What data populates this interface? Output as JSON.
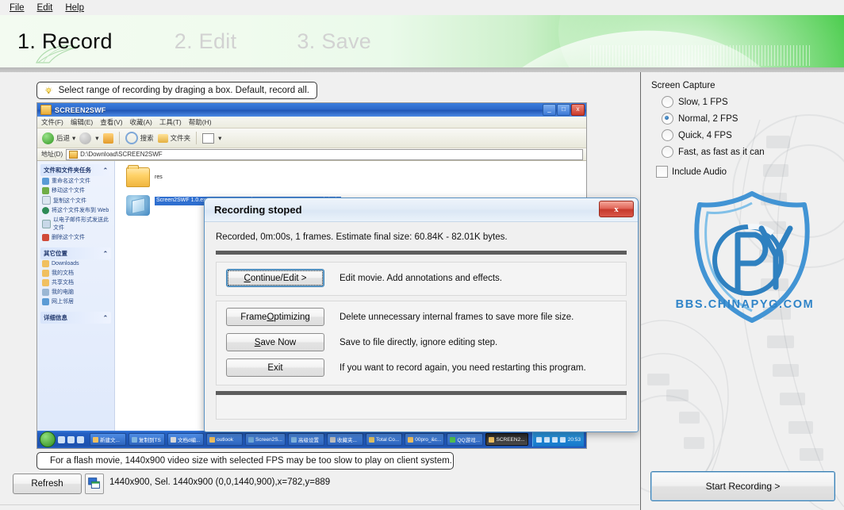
{
  "menubar": {
    "items": [
      {
        "label": "File",
        "accel": "F"
      },
      {
        "label": "Edit",
        "accel": "E"
      },
      {
        "label": "Help",
        "accel": "H"
      }
    ]
  },
  "banner": {
    "steps": [
      {
        "label": "1. Record",
        "active": true
      },
      {
        "label": "2. Edit",
        "active": false
      },
      {
        "label": "3. Save",
        "active": false
      }
    ]
  },
  "hints": {
    "top": "Select range of recording by draging a box. Default, record all.",
    "bottom": "For a flash movie, 1440x900 video size with selected FPS may be too slow to play on client system."
  },
  "preview": {
    "window_title": "SCREEN2SWF",
    "menu_items": [
      "文件(F)",
      "编辑(E)",
      "查看(V)",
      "收藏(A)",
      "工具(T)",
      "帮助(H)"
    ],
    "toolbar": {
      "back": "后退",
      "search": "搜索",
      "folders": "文件夹"
    },
    "address_label": "地址(D)",
    "address_value": "D:\\Download\\SCREEN2SWF",
    "side_panels": [
      {
        "title": "文件和文件夹任务",
        "rows": [
          {
            "label": "重命名这个文件",
            "color": "#5b9bd5"
          },
          {
            "label": "移动这个文件",
            "color": "#70ad47"
          },
          {
            "label": "复制这个文件",
            "color": "#dbe5f1"
          },
          {
            "label": "将这个文件发布到 Web",
            "color": "#2e8b57"
          },
          {
            "label": "以电子邮件形式发送此文件",
            "color": "#c8d8e8"
          },
          {
            "label": "删除这个文件",
            "color": "#d04a3a"
          }
        ]
      },
      {
        "title": "其它位置",
        "rows": [
          {
            "label": "Downloads",
            "color": "#f0c060"
          },
          {
            "label": "我的文档",
            "color": "#f0c060"
          },
          {
            "label": "共享文档",
            "color": "#f0c060"
          },
          {
            "label": "我的电脑",
            "color": "#9bb7d4"
          },
          {
            "label": "网上邻居",
            "color": "#5b9bd5"
          }
        ]
      },
      {
        "title": "详细信息",
        "rows": []
      }
    ],
    "files": [
      {
        "name": "res",
        "type": "folder",
        "selected": false
      },
      {
        "name": "Screen2SWF  1.0.exe\nSCREEN2SWF / SCREEN2SWF\nScreen movie/Job,",
        "type": "exe",
        "selected": true
      }
    ],
    "taskbar": {
      "buttons": [
        {
          "label": "新建文...",
          "color": "#f0c060",
          "active": false
        },
        {
          "label": "复制到TS",
          "color": "#7fb4e0",
          "active": false
        },
        {
          "label": "文档d编...",
          "color": "#d8d8d8",
          "active": false
        },
        {
          "label": "outlook",
          "color": "#f0c060",
          "active": false
        },
        {
          "label": "Screen2S...",
          "color": "#6fa8d8",
          "active": false
        },
        {
          "label": "高级设置",
          "color": "#7fb4e0",
          "active": false
        },
        {
          "label": "收藏夹...",
          "color": "#bfbfbf",
          "active": false
        },
        {
          "label": "Total Co...",
          "color": "#e0c060",
          "active": false
        },
        {
          "label": "00pro_&c...",
          "color": "#f0c060",
          "active": false
        },
        {
          "label": "QQ游戏...",
          "color": "#4fc04f",
          "active": false
        },
        {
          "label": "SCREEN2...",
          "color": "#f0c060",
          "active": true
        }
      ],
      "clock": "20:53"
    }
  },
  "dialog": {
    "title": "Recording stoped",
    "close_label": "x",
    "message": "Recorded, 0m:00s, 1 frames. Estimate final size: 60.84K - 82.01K bytes.",
    "rows": [
      {
        "button": "Continue/Edit >",
        "accel": "C",
        "accel_rest": "ontinue/Edit >",
        "description": "Edit movie. Add annotations and effects.",
        "focused": true
      },
      {
        "button": "Frame Optimizing",
        "accel": "O",
        "accel_pre": "Frame ",
        "accel_rest": "ptimizing",
        "description": "Delete unnecessary internal frames to save more file size.",
        "focused": false
      },
      {
        "button": "Save Now",
        "accel": "S",
        "accel_rest": "ave Now",
        "description": "Save to file directly, ignore editing step.",
        "focused": false
      },
      {
        "button": "Exit",
        "accel": "",
        "accel_rest": "Exit",
        "description": "If you want to record again, you need restarting this program.",
        "focused": false
      }
    ]
  },
  "sidebar": {
    "group_label": "Screen Capture",
    "options": [
      {
        "label": "Slow, 1 FPS",
        "selected": false
      },
      {
        "label": "Normal, 2 FPS",
        "selected": true
      },
      {
        "label": "Quick, 4 FPS",
        "selected": false
      },
      {
        "label": "Fast, as fast as it can",
        "selected": false
      }
    ],
    "include_audio": {
      "label": "Include Audio",
      "checked": false
    },
    "watermark_text": "BBS.CHINAPYG.COM",
    "watermark_letters": "CPY",
    "start_button": "Start Recording >"
  },
  "footer": {
    "refresh_label": "Refresh",
    "status": "1440x900, Sel. 1440x900 (0,0,1440,900),x=782,y=889"
  },
  "colors": {
    "banner_green": "#49cc4b",
    "accent_blue": "#3c7fb1",
    "watermark_blue": "#2f84c8",
    "dialog_border": "#5c93c4"
  }
}
